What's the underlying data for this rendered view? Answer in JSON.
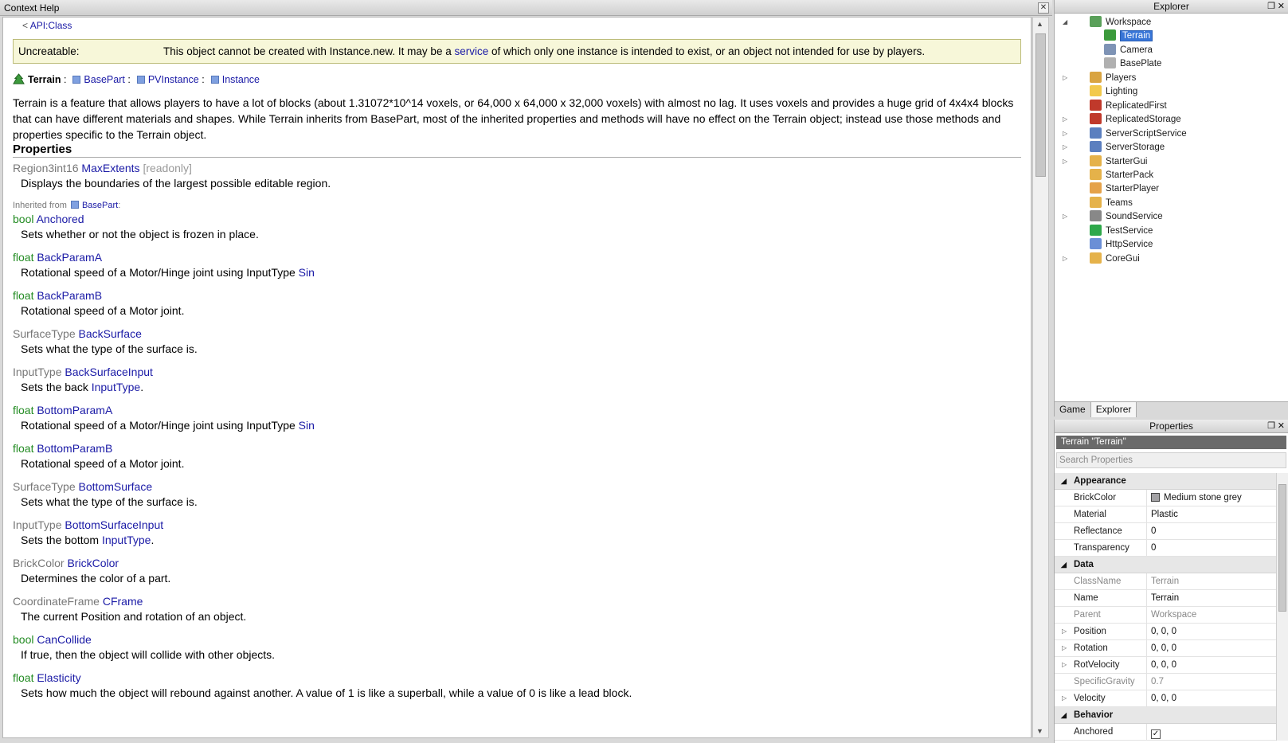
{
  "help": {
    "title": "Context Help",
    "close_glyph": "✕",
    "back_prefix": "< ",
    "back_link": "API:Class",
    "uncreatable_label": "Uncreatable:",
    "uncreatable_text_1": "This object cannot be created with Instance.new. It may be a ",
    "uncreatable_link": "service",
    "uncreatable_text_2": " of which only one instance is intended to exist, or an object not intended for use by players.",
    "class_name": "Terrain",
    "chain": [
      "BasePart",
      "PVInstance",
      "Instance"
    ],
    "chain_sep": ":",
    "description": "Terrain is a feature that allows players to have a lot of blocks (about 1.31072*10^14 voxels, or 64,000 x 64,000 x 32,000 voxels) with almost no lag. It uses voxels and provides a huge grid of 4x4x4 blocks that can have different materials and shapes. While Terrain inherits from BasePart, most of the inherited properties and methods will have no effect on the Terrain object; instead use those methods and properties specific to the Terrain object.",
    "properties_heading": "Properties",
    "own_property": {
      "type": "Region3int16",
      "name": "MaxExtents",
      "tag": "[readonly]",
      "desc": "Displays the boundaries of the largest possible editable region."
    },
    "inherited_label": "Inherited from",
    "inherited_class": "BasePart",
    "inherited_suffix": ":",
    "props": [
      {
        "type": "bool",
        "name": "Anchored",
        "desc": "Sets whether or not the object is frozen in place."
      },
      {
        "type": "float",
        "name": "BackParamA",
        "desc": "Rotational speed of a Motor/Hinge joint using InputType ",
        "link": "Sin"
      },
      {
        "type": "float",
        "name": "BackParamB",
        "desc": "Rotational speed of a Motor joint."
      },
      {
        "type": "SurfaceType",
        "name": "BackSurface",
        "desc": "Sets what the type of the surface is."
      },
      {
        "type": "InputType",
        "name": "BackSurfaceInput",
        "desc": "Sets the back ",
        "link": "InputType",
        "after": "."
      },
      {
        "type": "float",
        "name": "BottomParamA",
        "desc": "Rotational speed of a Motor/Hinge joint using InputType ",
        "link": "Sin"
      },
      {
        "type": "float",
        "name": "BottomParamB",
        "desc": "Rotational speed of a Motor joint."
      },
      {
        "type": "SurfaceType",
        "name": "BottomSurface",
        "desc": "Sets what the type of the surface is."
      },
      {
        "type": "InputType",
        "name": "BottomSurfaceInput",
        "desc": "Sets the bottom ",
        "link": "InputType",
        "after": "."
      },
      {
        "type": "BrickColor",
        "name": "BrickColor",
        "desc": "Determines the color of a part."
      },
      {
        "type": "CoordinateFrame",
        "name": "CFrame",
        "desc": "The current Position and rotation of an object."
      },
      {
        "type": "bool",
        "name": "CanCollide",
        "desc": "If true, then the object will collide with other objects."
      },
      {
        "type": "float",
        "name": "Elasticity",
        "desc": "Sets how much the object will rebound against another. A value of 1 is like a superball, while a value of 0 is like a lead block."
      }
    ]
  },
  "explorer": {
    "title": "Explorer",
    "tabs": [
      "Game",
      "Explorer"
    ],
    "tree": [
      {
        "label": "Workspace",
        "color": "#5aa05a",
        "expand": "◢"
      },
      {
        "label": "Terrain",
        "color": "#3c9a3c",
        "selected": true
      },
      {
        "label": "Camera",
        "color": "#7e93b5"
      },
      {
        "label": "BasePlate",
        "color": "#b0b0b0"
      },
      {
        "label": "Players",
        "color": "#d9a441",
        "expand": "▷"
      },
      {
        "label": "Lighting",
        "color": "#f2c94c"
      },
      {
        "label": "ReplicatedFirst",
        "color": "#c0392b"
      },
      {
        "label": "ReplicatedStorage",
        "color": "#c0392b",
        "expand": "▷"
      },
      {
        "label": "ServerScriptService",
        "color": "#5b7fbf",
        "expand": "▷"
      },
      {
        "label": "ServerStorage",
        "color": "#5b7fbf",
        "expand": "▷"
      },
      {
        "label": "StarterGui",
        "color": "#e5b24a",
        "expand": "▷"
      },
      {
        "label": "StarterPack",
        "color": "#e5b24a"
      },
      {
        "label": "StarterPlayer",
        "color": "#e5a24a"
      },
      {
        "label": "Teams",
        "color": "#e5b24a"
      },
      {
        "label": "SoundService",
        "color": "#888888",
        "expand": "▷"
      },
      {
        "label": "TestService",
        "color": "#2ea84a"
      },
      {
        "label": "HttpService",
        "color": "#6b8fd6"
      },
      {
        "label": "CoreGui",
        "color": "#e5b24a",
        "expand": "▷"
      }
    ]
  },
  "properties": {
    "title": "Properties",
    "selection": "Terrain \"Terrain\"",
    "search_placeholder": "Search Properties",
    "categories": [
      {
        "name": "Appearance",
        "rows": [
          {
            "name": "BrickColor",
            "value": "Medium stone grey",
            "swatch": "#a3a2a5"
          },
          {
            "name": "Material",
            "value": "Plastic"
          },
          {
            "name": "Reflectance",
            "value": "0"
          },
          {
            "name": "Transparency",
            "value": "0"
          }
        ]
      },
      {
        "name": "Data",
        "rows": [
          {
            "name": "ClassName",
            "value": "Terrain",
            "readonly": true
          },
          {
            "name": "Name",
            "value": "Terrain"
          },
          {
            "name": "Parent",
            "value": "Workspace",
            "readonly": true
          },
          {
            "name": "Position",
            "value": "0, 0, 0",
            "expand": true
          },
          {
            "name": "Rotation",
            "value": "0, 0, 0",
            "expand": true
          },
          {
            "name": "RotVelocity",
            "value": "0, 0, 0",
            "expand": true
          },
          {
            "name": "SpecificGravity",
            "value": "0.7",
            "readonly": true
          },
          {
            "name": "Velocity",
            "value": "0, 0, 0",
            "expand": true
          }
        ]
      },
      {
        "name": "Behavior",
        "rows": [
          {
            "name": "Anchored",
            "value": "✓",
            "checkbox": true
          }
        ]
      }
    ]
  }
}
